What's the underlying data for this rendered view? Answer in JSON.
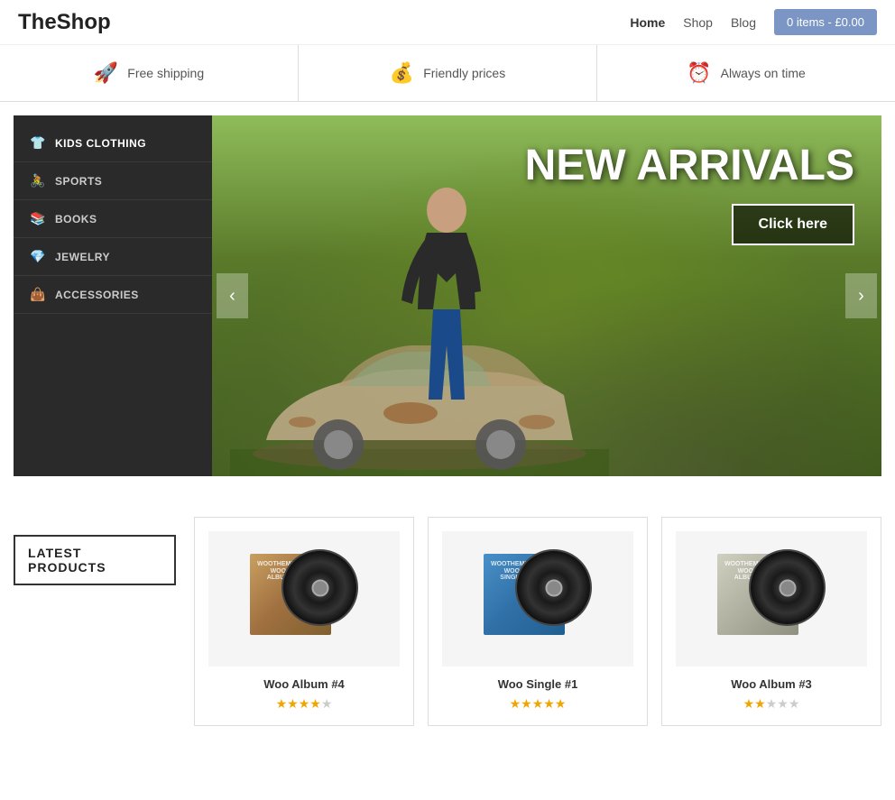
{
  "header": {
    "logo": "TheShop",
    "nav": [
      {
        "label": "Home",
        "active": true
      },
      {
        "label": "Shop",
        "active": false
      },
      {
        "label": "Blog",
        "active": false
      }
    ],
    "cart": {
      "label": "0 items - £0.00",
      "icon": "🛒"
    }
  },
  "features": [
    {
      "icon": "🚀",
      "text": "Free shipping",
      "name": "free-shipping"
    },
    {
      "icon": "💰",
      "text": "Friendly prices",
      "name": "friendly-prices"
    },
    {
      "icon": "⏰",
      "text": "Always on time",
      "name": "always-on-time"
    }
  ],
  "sidebar": {
    "items": [
      {
        "label": "Kids Clothing",
        "icon": "👕",
        "name": "kids-clothing"
      },
      {
        "label": "Sports",
        "icon": "🚴",
        "name": "sports"
      },
      {
        "label": "Books",
        "icon": "📚",
        "name": "books"
      },
      {
        "label": "Jewelry",
        "icon": "💎",
        "name": "jewelry"
      },
      {
        "label": "Accessories",
        "icon": "👜",
        "name": "accessories"
      }
    ]
  },
  "slider": {
    "title": "NEW ARRIVALS",
    "button_label": "Click here",
    "prev_label": "‹",
    "next_label": "›"
  },
  "products_section": {
    "heading": "LATEST PRODUCTS",
    "products": [
      {
        "name": "Woo Album #4",
        "stars": 4,
        "max_stars": 5,
        "sleeve_color": "brown",
        "sleeve_text": "WOOTHEMES\nWOO\nALBUM"
      },
      {
        "name": "Woo Single #1",
        "stars": 5,
        "max_stars": 5,
        "sleeve_color": "blue",
        "sleeve_text": "WOOTHEMES\nWOO\nSINGLE"
      },
      {
        "name": "Woo Album #3",
        "stars": 2,
        "max_stars": 5,
        "sleeve_color": "grey",
        "sleeve_text": "WOOTHEMES\nWOO\nALBUM"
      }
    ]
  }
}
